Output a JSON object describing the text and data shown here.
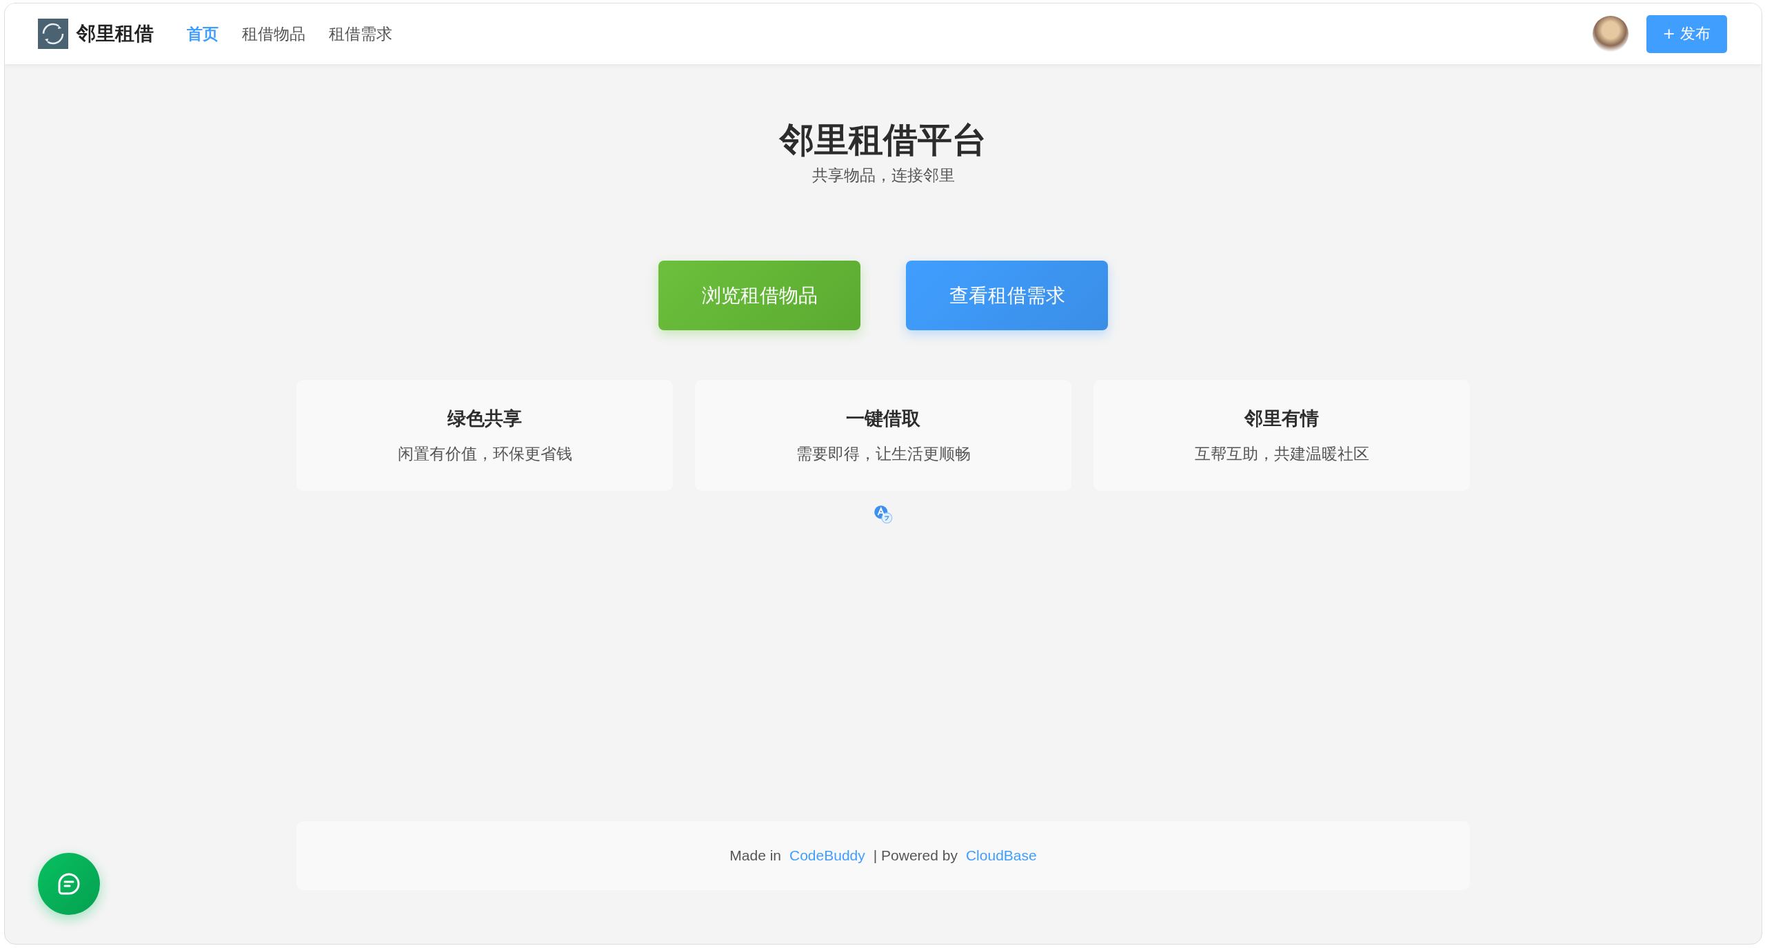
{
  "header": {
    "brand": "邻里租借",
    "nav": [
      {
        "label": "首页",
        "selected": true
      },
      {
        "label": "租借物品",
        "selected": false
      },
      {
        "label": "租借需求",
        "selected": false
      }
    ],
    "publish_button": "+ 发布"
  },
  "hero": {
    "title": "邻里租借平台",
    "subtitle": "共享物品，连接邻里"
  },
  "actions": [
    {
      "label": "浏览租借物品",
      "kind": "green"
    },
    {
      "label": "查看租借需求",
      "kind": "blue"
    }
  ],
  "features": [
    {
      "title": "绿色共享",
      "description": "闲置有价值，环保更省钱"
    },
    {
      "title": "一键借取",
      "description": "需要即得，让生活更顺畅"
    },
    {
      "title": "邻里有情",
      "description": "互帮互助，共建温暖社区"
    }
  ],
  "footer": {
    "made_in": "Made in",
    "made_link": "CodeBuddy",
    "powered_by": "| Powered by",
    "powered_link": "CloudBase"
  }
}
